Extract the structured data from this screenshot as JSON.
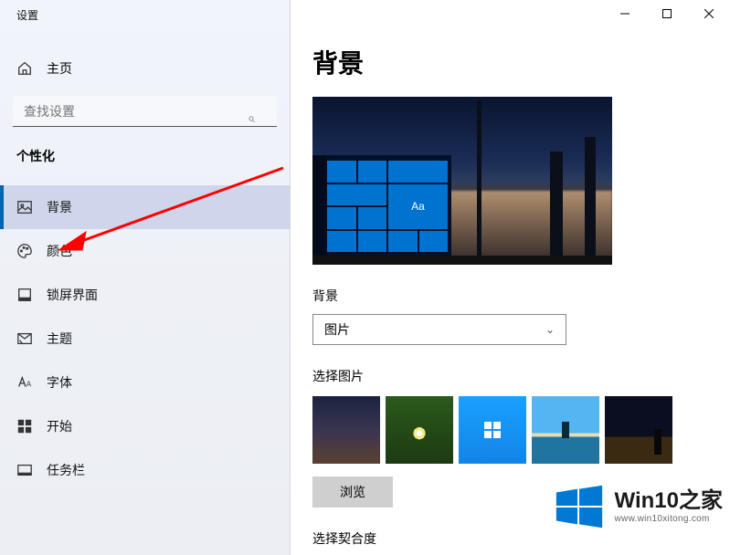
{
  "window_title": "设置",
  "home_label": "主页",
  "search_placeholder": "查找设置",
  "category_label": "个性化",
  "nav": [
    {
      "id": "background",
      "label": "背景",
      "icon": "image-icon",
      "active": true
    },
    {
      "id": "colors",
      "label": "颜色",
      "icon": "palette-icon",
      "active": false
    },
    {
      "id": "lockscreen",
      "label": "锁屏界面",
      "icon": "lockscreen-icon",
      "active": false
    },
    {
      "id": "themes",
      "label": "主题",
      "icon": "theme-icon",
      "active": false
    },
    {
      "id": "fonts",
      "label": "字体",
      "icon": "font-icon",
      "active": false
    },
    {
      "id": "start",
      "label": "开始",
      "icon": "start-icon",
      "active": false
    },
    {
      "id": "taskbar",
      "label": "任务栏",
      "icon": "taskbar-icon",
      "active": false
    }
  ],
  "page_heading": "背景",
  "preview_tile_text": "Aa",
  "background_section_label": "背景",
  "background_dropdown_value": "图片",
  "choose_picture_label": "选择图片",
  "thumbnails": [
    "city-dusk",
    "daisy-grass",
    "windows-blue",
    "beach",
    "desert-night"
  ],
  "browse_label": "浏览",
  "choose_fit_label": "选择契合度",
  "watermark": {
    "brand": "Win10之家",
    "url": "www.win10xitong.com"
  }
}
